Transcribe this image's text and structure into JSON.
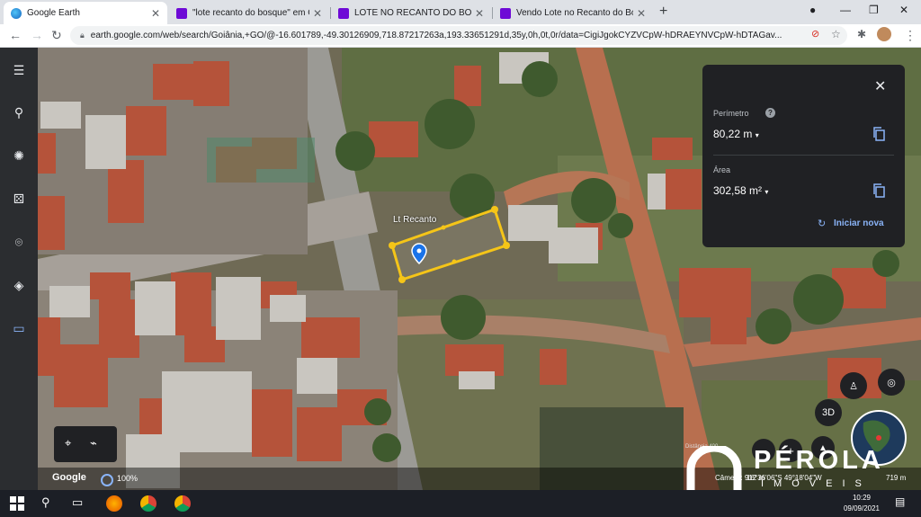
{
  "browser": {
    "tabs": [
      {
        "label": "Google Earth",
        "active": true
      },
      {
        "label": "\"lote recanto do bosque\" em Go",
        "active": false
      },
      {
        "label": "LOTE NO RECANTO DO BOSQUE",
        "active": false
      },
      {
        "label": "Vendo Lote no Recanto do Bosqu",
        "active": false
      }
    ],
    "new_tab": "+",
    "url": "earth.google.com/web/search/Goiânia,+GO/@-16.601789,-49.30126909,718.87217263a,193.33651291d,35y,0h,0t,0r/data=CigiJgokCYZVCpW-hDRAEYNVCpW-hDTAGav..."
  },
  "map": {
    "placemark_label": "Lt Recanto",
    "attribution": "Google",
    "zoom": "100%",
    "camera": "Câmera: 912 m",
    "coordinates": "16°36'06\"S 49°18'04\"W",
    "elevation": "719 m",
    "distance_label": "Distância 400"
  },
  "measure_panel": {
    "perimeter_label": "Perímetro",
    "perimeter_value": "80,22 m",
    "area_label": "Área",
    "area_value": "302,58 m²",
    "new_button": "Iniciar nova"
  },
  "controls": {
    "three_d": "3D"
  },
  "watermark": {
    "brand": "PÉROLA",
    "sub": "IMÓVEIS"
  },
  "taskbar": {
    "time": "10:29",
    "date": "09/09/2021"
  },
  "colors": {
    "polygon": "#f5c518",
    "placemark": "#1a73e8",
    "link": "#8ab4f8"
  }
}
